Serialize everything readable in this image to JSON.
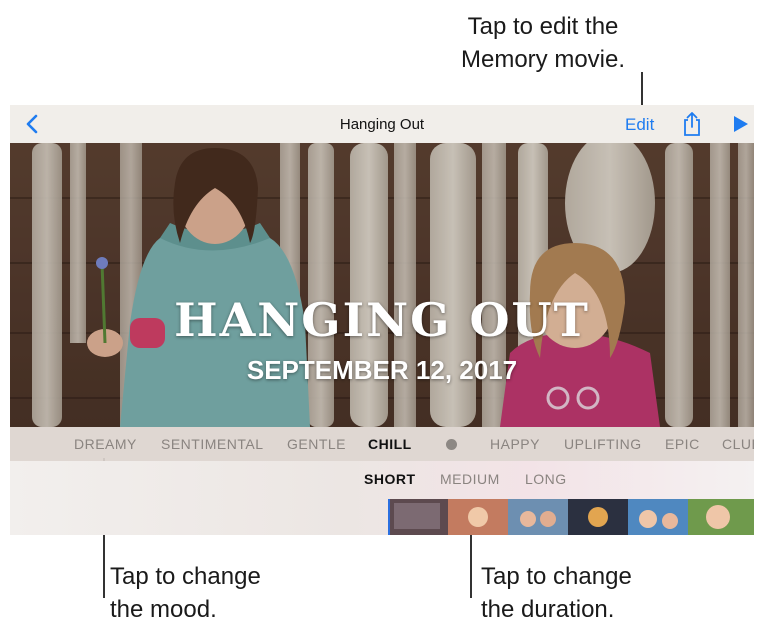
{
  "callouts": {
    "edit": "Tap to edit the\nMemory movie.",
    "mood": "Tap to change\nthe mood.",
    "duration": "Tap to change\nthe duration."
  },
  "navbar": {
    "title": "Hanging Out",
    "edit_label": "Edit",
    "back_icon": "chevron-left-icon",
    "share_icon": "share-icon",
    "play_icon": "play-icon",
    "accent": "#1f7cf0"
  },
  "memory": {
    "title": "HANGING OUT",
    "date": "SEPTEMBER 12, 2017"
  },
  "moods": {
    "items": [
      "DREAMY",
      "SENTIMENTAL",
      "GENTLE",
      "CHILL",
      "HAPPY",
      "UPLIFTING",
      "EPIC",
      "CLUB"
    ],
    "selected": "CHILL"
  },
  "durations": {
    "items": [
      "SHORT",
      "MEDIUM",
      "LONG"
    ],
    "selected": "SHORT"
  }
}
